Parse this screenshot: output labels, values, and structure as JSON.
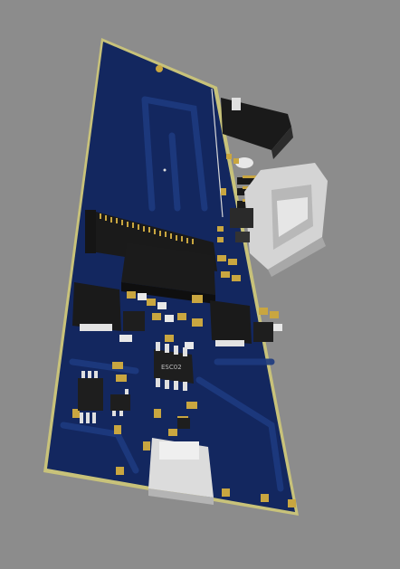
{
  "scene": {
    "background_color": "#8c8c8c",
    "board_color": "#13275f",
    "board_edge_color": "#c8c27a",
    "trace_color": "#1b3577",
    "pad_color": "#c9a640",
    "component_color": "#1a1a1a",
    "connector_color": "#cfcfcf"
  },
  "labels": {
    "chip_marking": "ESC02"
  }
}
